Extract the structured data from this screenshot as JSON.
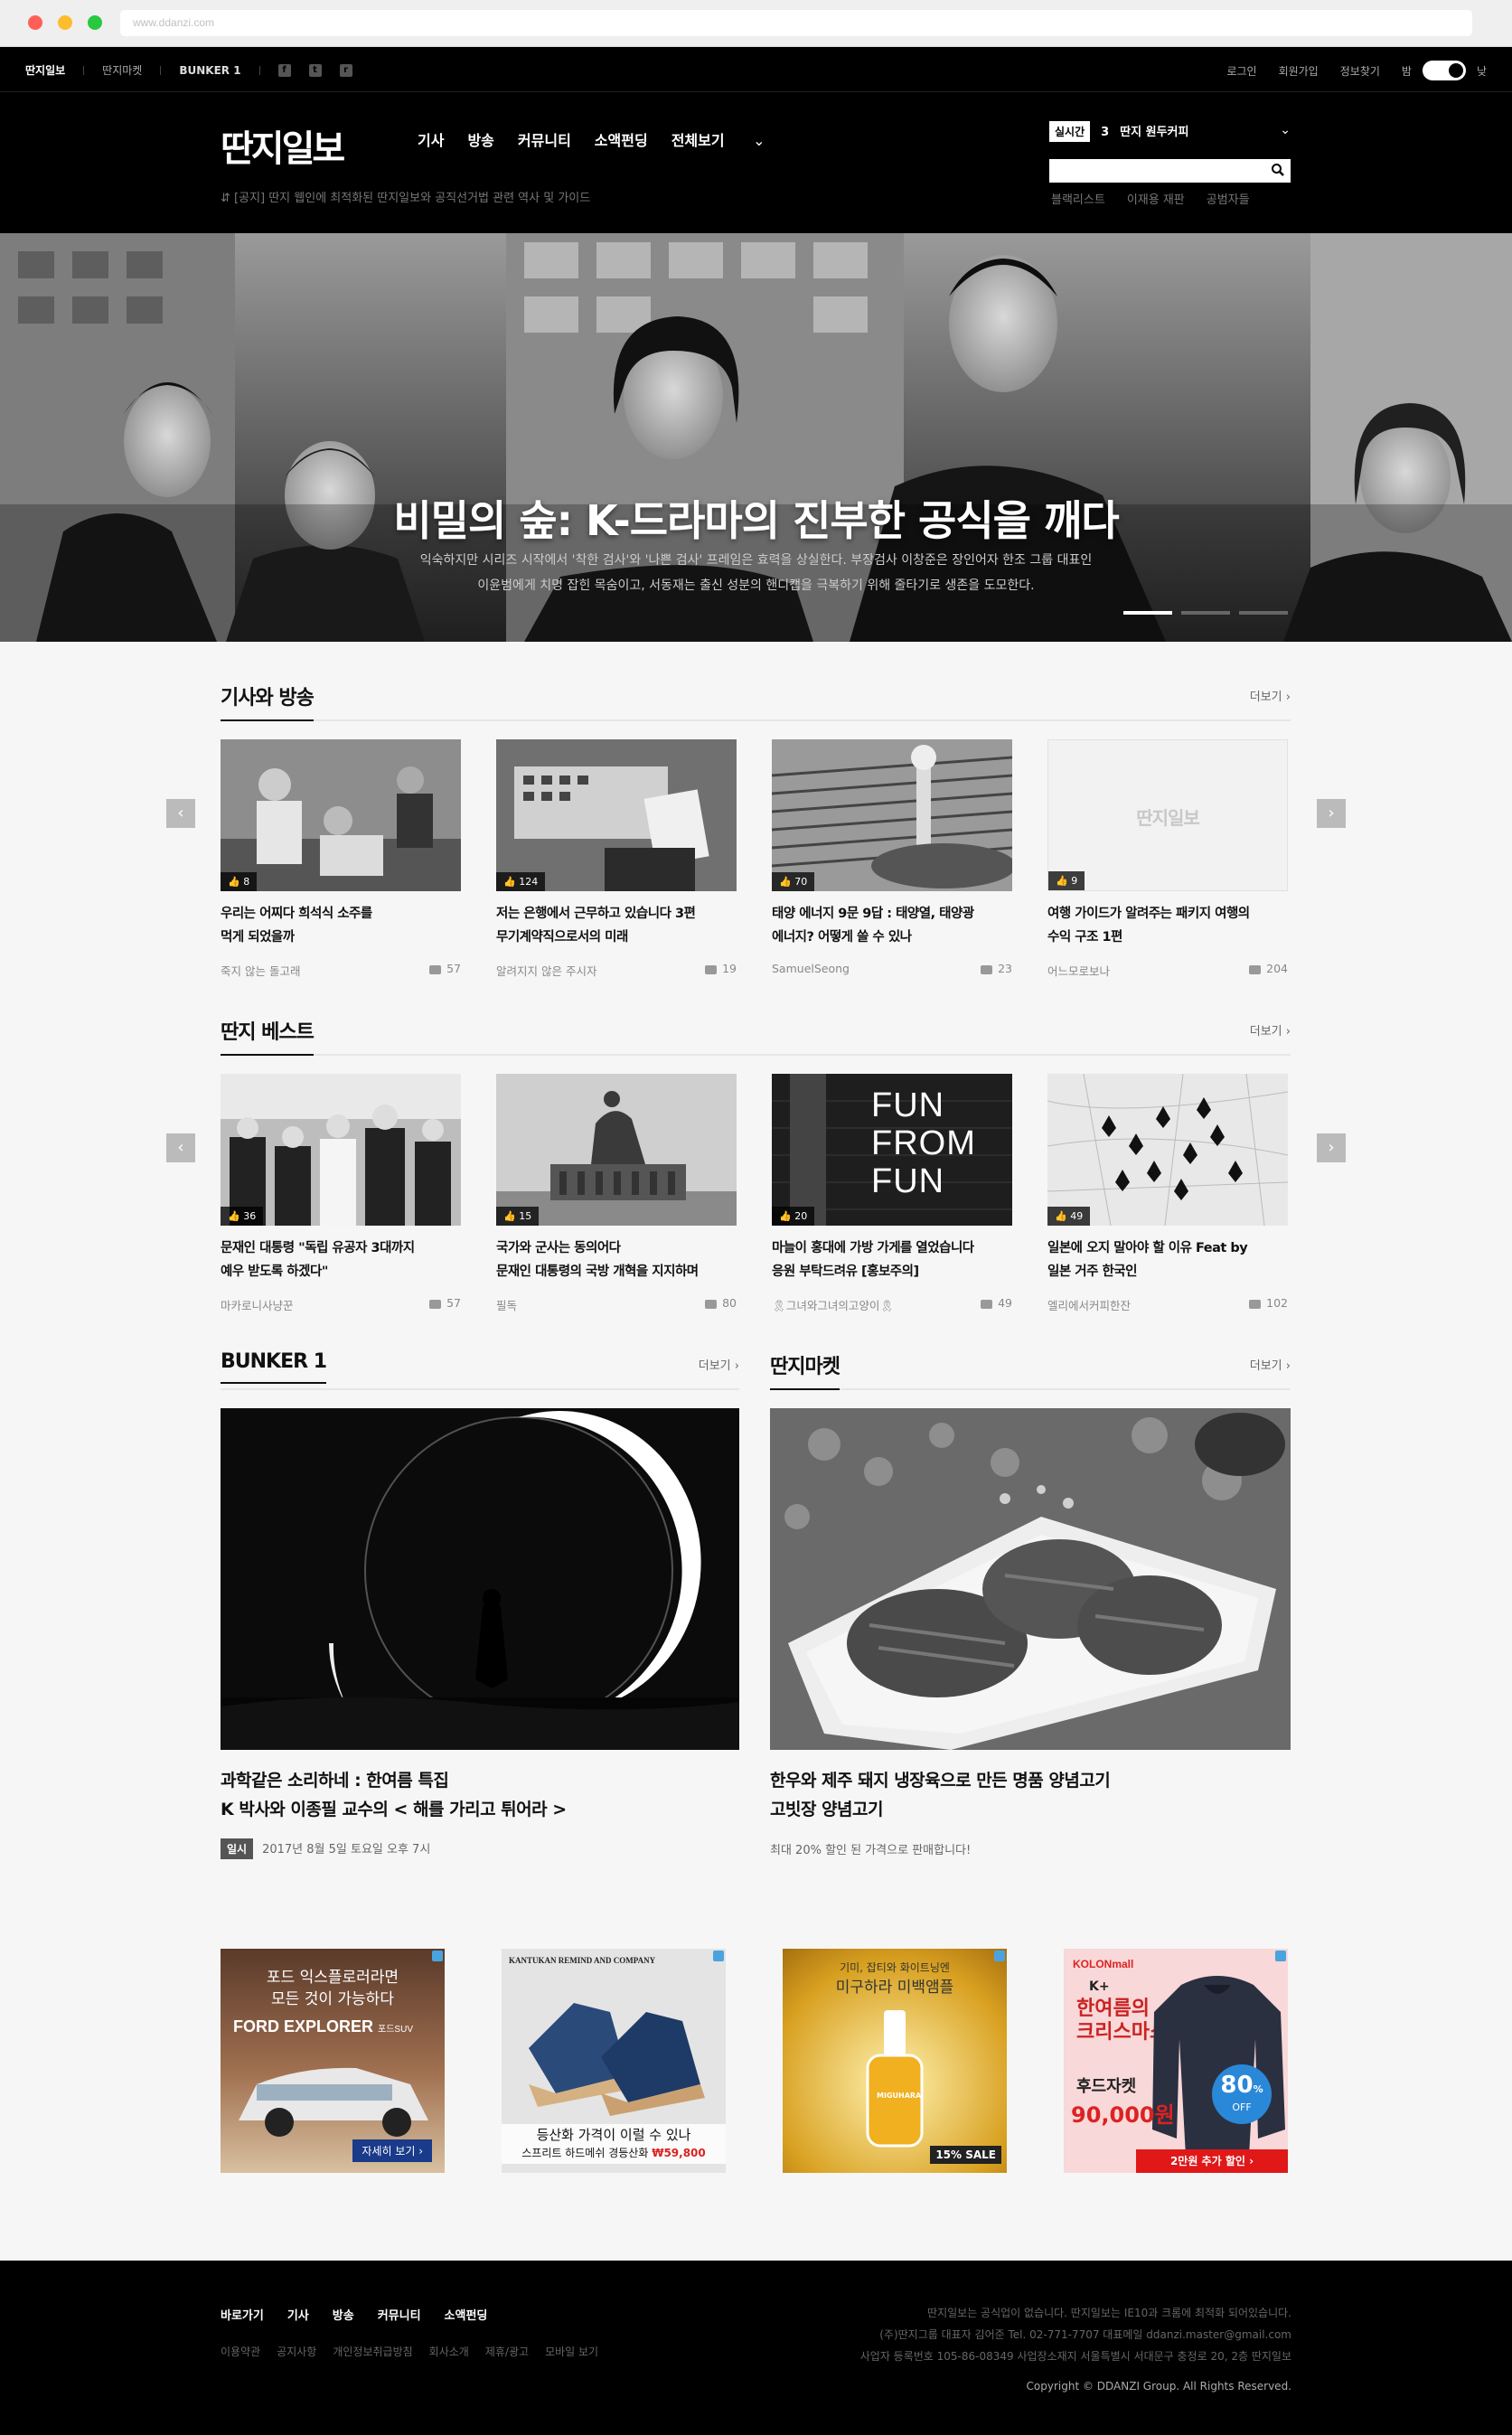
{
  "browser": {
    "url": "www.ddanzi.com"
  },
  "topbar": {
    "links": [
      "딴지일보",
      "딴지마켓",
      "BUNKER 1"
    ],
    "social": [
      "facebook-icon",
      "twitter-icon",
      "rss-icon"
    ],
    "right": [
      "로그인",
      "회원가입",
      "정보찾기"
    ],
    "night_label": "밤",
    "day_label": "낮"
  },
  "header": {
    "logo": "딴지일보",
    "nav": [
      "기사",
      "방송",
      "커뮤니티",
      "소액펀딩",
      "전체보기"
    ],
    "notice": "[공지] 딴지 웹인에 최적화된 딴지일보와 공직선거법 관련 역사 및 가이드",
    "realtime_badge": "실시간",
    "realtime_rank": "3",
    "realtime_text": "딴지 원두커피",
    "search_placeholder": "",
    "keywords": [
      "블랙리스트",
      "이재용 재판",
      "공범자들"
    ]
  },
  "hero": {
    "title": "비밀의 숲: K-드라마의 진부한 공식을 깨다",
    "desc1": "익숙하지만 시리즈 시작에서 '착한 검사'와 '나쁜 검사' 프레임은 효력을 상실한다. 부장검사 이창준은 장인어자 한조 그룹 대표인",
    "desc2": "이윤범에게 치명 잡힌 목숨이고, 서동재는 출신 성분의 핸디캡을 극복하기 위해 줄타기로 생존을 도모한다."
  },
  "sections": {
    "articles": {
      "title": "기사와 방송",
      "more": "더보기",
      "cards": [
        {
          "likes": "8",
          "title1": "우리는 어찌다 희석식 소주를",
          "title2": "먹게 되었을까",
          "author": "죽지 않는 돌고래",
          "comments": "57"
        },
        {
          "likes": "124",
          "title1": "저는 은행에서 근무하고 있습니다 3편",
          "title2": "무기계약직으로서의 미래",
          "author": "알려지지 않은 주시자",
          "comments": "19"
        },
        {
          "likes": "70",
          "title1": "태양 에너지 9문 9답 : 태양열, 태양광",
          "title2": "에너지? 어떻게 쓸 수 있나",
          "author": "SamuelSeong",
          "comments": "23"
        },
        {
          "likes": "9",
          "title1": "여행 가이드가 알려주는 패키지 여행의",
          "title2": "수익 구조 1편",
          "author": "어느모로보나",
          "comments": "204",
          "placeholder": "딴지일보"
        }
      ]
    },
    "best": {
      "title": "딴지 베스트",
      "more": "더보기",
      "cards": [
        {
          "likes": "36",
          "title1": "문재인 대통령 \"독립 유공자 3대까지",
          "title2": "예우 받도록 하겠다\"",
          "author": "마카로니사냥꾼",
          "comments": "57"
        },
        {
          "likes": "15",
          "title1": "국가와 군사는 동의어다",
          "title2": "문재인 대통령의 국방 개혁을 지지하며",
          "author": "필독",
          "comments": "80"
        },
        {
          "likes": "20",
          "title1": "마늘이 홍대에 가방 가게를 열었습니다",
          "title2": "응원 부탁드려유 [홍보주의]",
          "author": "🎗그녀와그녀의고양이🎗",
          "comments": "49",
          "sign": "FUN FROM FUN"
        },
        {
          "likes": "49",
          "title1": "일본에 오지 말아야 할 이유 Feat by",
          "title2": "일본 거주 한국인",
          "author": "엘리에서커피한잔",
          "comments": "102"
        }
      ]
    },
    "bunker": {
      "title": "BUNKER 1",
      "more": "더보기",
      "title1": "과학같은 소리하네 : 한여름 특집",
      "title2": "K 박사와 이종필 교수의 < 해를 가리고 튀어라 >",
      "badge": "일시",
      "date": "2017년 8월 5일 토요일 오후 7시"
    },
    "market": {
      "title": "딴지마켓",
      "more": "더보기",
      "title1": "한우와 제주 돼지 냉장육으로 만든 명품 양념고기",
      "title2": "고빗장 양념고기",
      "desc": "최대 20% 할인 된 가격으로 판매합니다!"
    }
  },
  "ads": [
    {
      "line1": "포드 익스플로러라면",
      "line2": "모든 것이 가능하다",
      "brand": "FORD EXPLORER",
      "sub": "포드SUV",
      "cta": "자세히 보기 ›"
    },
    {
      "brand": "KANTUKAN REMIND AND COMPANY",
      "line1": "등산화 가격이 이럴 수 있나",
      "line2": "스프리트 하드메쉬 경등산화",
      "price": "₩59,800"
    },
    {
      "line1": "기미, 잡티와 화이트닝엔",
      "line2": "미구하라 미백앰플",
      "product": "MIGUHARA",
      "sale": "15% SALE"
    },
    {
      "brand": "KOLONmall",
      "line1": "K+",
      "line2": "한여름의",
      "line3": "크리스마스",
      "product": "후드자켓",
      "price": "90,000원",
      "discount": "80",
      "off": "OFF",
      "cta": "2만원 추가 할인 ›"
    }
  ],
  "footer": {
    "nav": [
      "바로가기",
      "기사",
      "방송",
      "커뮤니티",
      "소액펀딩"
    ],
    "links": [
      "이용약관",
      "공지사항",
      "개인정보취급방침",
      "회사소개",
      "제휴/광고",
      "모바일 보기"
    ],
    "info1": "딴지일보는 공식업이 없습니다. 딴지일보는 IE10과 크롬에 최적화 되어있습니다.",
    "info2": "(주)딴지그룹 대표자 김어준 Tel. 02-771-7707 대표메일 ddanzi.master@gmail.com",
    "info3": "사업자 등록번호 105-86-08349 사업장소재지 서울특별시 서대문구 충정로 20, 2층 딴지일보",
    "copyright": "Copyright © DDANZI Group. All Rights Reserved."
  }
}
